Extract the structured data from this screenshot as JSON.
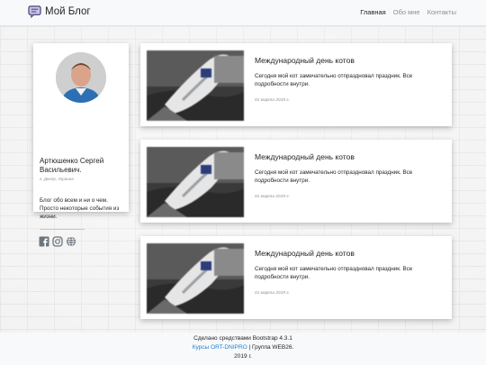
{
  "navbar": {
    "brand": "Мой Блог",
    "links": [
      {
        "label": "Главная",
        "active": true
      },
      {
        "label": "Обо мне",
        "active": false
      },
      {
        "label": "Контакты",
        "active": false
      }
    ]
  },
  "profile": {
    "name": "Артюшенко Сергей Васильевич.",
    "city": "г. Днепр, Украина",
    "description": "Блог обо всем и ни о чем. Просто некоторые события из жизни.",
    "socials": [
      "facebook-icon",
      "instagram-icon",
      "globe-icon"
    ]
  },
  "posts": [
    {
      "title": "Международный день котов",
      "text": "Сегодня мой кот замечательно отпраздновал праздник. Все подробности внутри.",
      "date": "01 марта 2019 г."
    },
    {
      "title": "Международный день котов",
      "text": "Сегодня мой кот замечательно отпраздновал праздник. Все подробности внутри.",
      "date": "01 марта 2019 г."
    },
    {
      "title": "Международный день котов",
      "text": "Сегодня мой кот замечательно отпраздновал праздник. Все подробности внутри.",
      "date": "01 марта 2019 г."
    }
  ],
  "footer": {
    "line1": "Сделано средствами Bootstrap 4.3.1",
    "link": "Курсы ORT-DNIPRO",
    "line2_rest": " | Группа WEB26.",
    "line3": "2019 г."
  },
  "colors": {
    "link": "#1a82d9",
    "muted": "#8a8f95",
    "navbar_bg": "#f8f9fa"
  }
}
